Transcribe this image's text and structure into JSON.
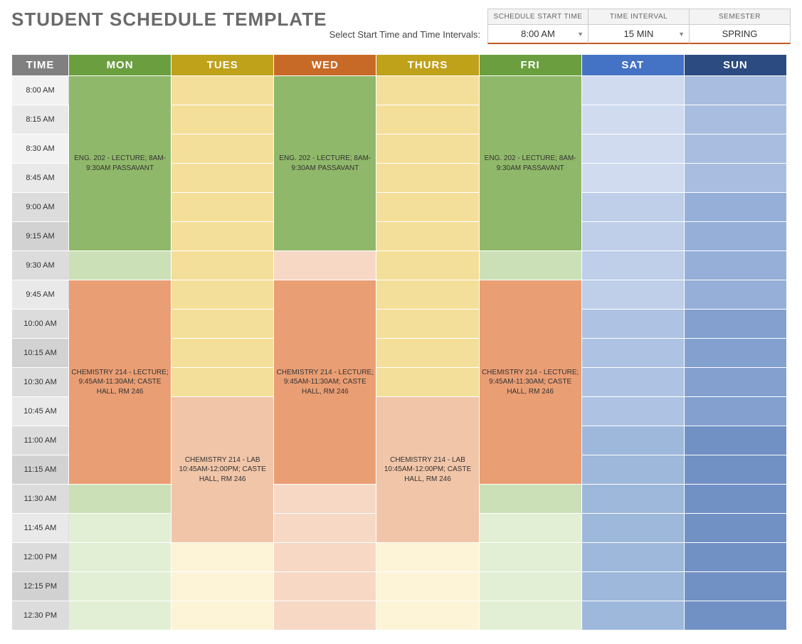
{
  "page_title": "STUDENT SCHEDULE TEMPLATE",
  "controls": {
    "prompt": "Select Start Time and Time Intervals:",
    "start_time_label": "SCHEDULE START TIME",
    "interval_label": "TIME INTERVAL",
    "semester_label": "SEMESTER",
    "start_time_value": "8:00 AM",
    "interval_value": "15 MIN",
    "semester_value": "SPRING"
  },
  "days": {
    "time": "TIME",
    "mon": "MON",
    "tues": "TUES",
    "wed": "WED",
    "thurs": "THURS",
    "fri": "FRI",
    "sat": "SAT",
    "sun": "SUN"
  },
  "time_slots": [
    "8:00 AM",
    "8:15 AM",
    "8:30 AM",
    "8:45 AM",
    "9:00 AM",
    "9:15 AM",
    "9:30 AM",
    "9:45 AM",
    "10:00 AM",
    "10:15 AM",
    "10:30 AM",
    "10:45 AM",
    "11:00 AM",
    "11:15 AM",
    "11:30 AM",
    "11:45 AM",
    "12:00 PM",
    "12:15 PM",
    "12:30 PM"
  ],
  "events": {
    "eng202": "ENG. 202 - LECTURE; 8AM-9:30AM PASSAVANT",
    "chem214_lecture": "CHEMISTRY 214 - LECTURE; 9:45AM-11:30AM; CASTE HALL, RM 246",
    "chem214_lab": "CHEMISTRY 214 - LAB 10:45AM-12:00PM; CASTE HALL, RM 246"
  },
  "schedule": {
    "mon": [
      {
        "event": "eng202",
        "start": "8:00 AM",
        "end": "9:30 AM"
      },
      {
        "event": "chem214_lecture",
        "start": "9:45 AM",
        "end": "11:30 AM"
      }
    ],
    "tues": [
      {
        "event": "chem214_lab",
        "start": "10:45 AM",
        "end": "12:00 PM"
      }
    ],
    "wed": [
      {
        "event": "eng202",
        "start": "8:00 AM",
        "end": "9:30 AM"
      },
      {
        "event": "chem214_lecture",
        "start": "9:45 AM",
        "end": "11:30 AM"
      }
    ],
    "thurs": [
      {
        "event": "chem214_lab",
        "start": "10:45 AM",
        "end": "12:00 PM"
      }
    ],
    "fri": [
      {
        "event": "eng202",
        "start": "8:00 AM",
        "end": "9:30 AM"
      },
      {
        "event": "chem214_lecture",
        "start": "9:45 AM",
        "end": "11:30 AM"
      }
    ],
    "sat": [],
    "sun": []
  }
}
